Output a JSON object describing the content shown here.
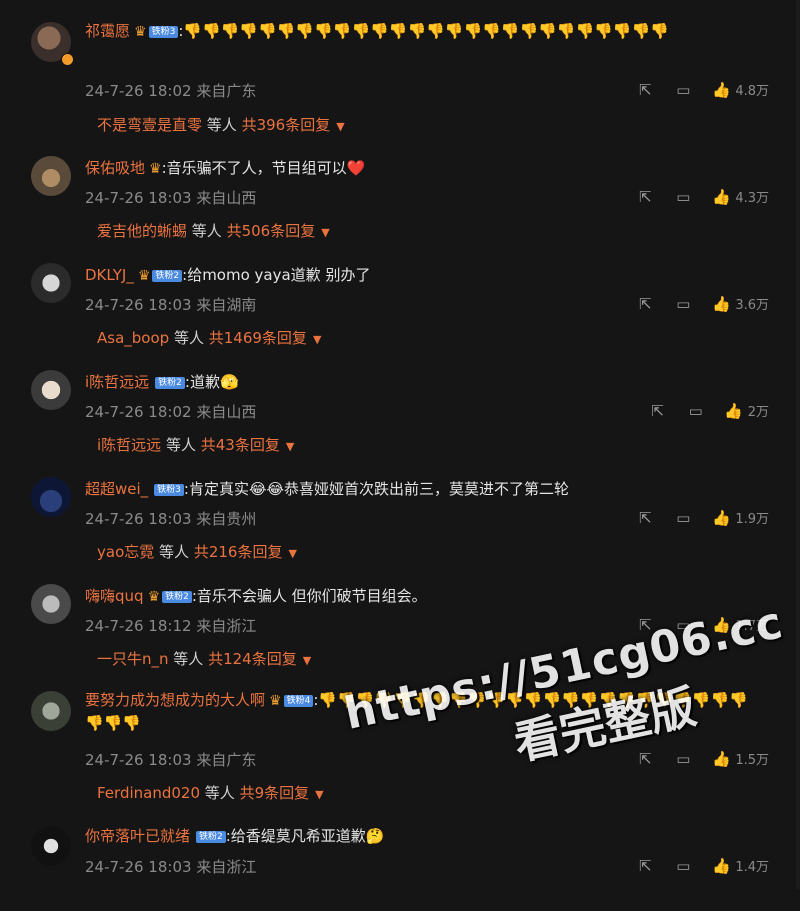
{
  "comments": [
    {
      "name": "祁霭愿",
      "fan": "铁粉3",
      "text": ":👎👎👎👎👎👎👎👎👎👎👎👎👎👎👎👎👎👎👎👎👎👎👎👎👎👎",
      "date": "24-7-26 18:02",
      "loc": "来自广东",
      "likes": "4.8万",
      "reply_user": "不是弯壹是直零",
      "reply_mid": "等人",
      "reply_count": "共396条回复"
    },
    {
      "name": "保佑吸地",
      "fan": "",
      "text": ":音乐骗不了人，节目组可以❤️",
      "date": "24-7-26 18:03",
      "loc": "来自山西",
      "likes": "4.3万",
      "reply_user": "爱吉他的蜥蜴",
      "reply_mid": "等人",
      "reply_count": "共506条回复"
    },
    {
      "name": "DKLYJ_",
      "fan": "铁粉2",
      "text": ":给momo yaya道歉 别办了",
      "date": "24-7-26 18:03",
      "loc": "来自湖南",
      "likes": "3.6万",
      "reply_user": "Asa_boop",
      "reply_mid": "等人",
      "reply_count": "共1469条回复"
    },
    {
      "name": "i陈哲远远",
      "fan": "铁粉2",
      "text": ":道歉🫣",
      "date": "24-7-26 18:02",
      "loc": "来自山西",
      "likes": "2万",
      "reply_user": "i陈哲远远",
      "reply_mid": "等人",
      "reply_count": "共43条回复"
    },
    {
      "name": "超超wei_",
      "fan": "铁粉3",
      "text": ":肯定真实😂😂恭喜娅娅首次跌出前三，莫莫进不了第二轮",
      "date": "24-7-26 18:03",
      "loc": "来自贵州",
      "likes": "1.9万",
      "reply_user": "yao忘霓",
      "reply_mid": "等人",
      "reply_count": "共216条回复"
    },
    {
      "name": "嗨嗨quq",
      "fan": "铁粉2",
      "text": ":音乐不会骗人 但你们破节目组会。",
      "date": "24-7-26 18:12",
      "loc": "来自浙江",
      "likes": "1.7万",
      "reply_user": "一只牛n_n",
      "reply_mid": "等人",
      "reply_count": "共124条回复"
    },
    {
      "name": "要努力成为想成为的大人啊",
      "fan": "铁粉4",
      "text": ":👎👎👎👎👎👎👎👎👎👎👎👎👎👎👎👎👎👎👎👎👎👎👎👎👎👎",
      "date": "24-7-26 18:03",
      "loc": "来自广东",
      "likes": "1.5万",
      "reply_user": "Ferdinand020",
      "reply_mid": "等人",
      "reply_count": "共9条回复"
    },
    {
      "name": "你帝落叶已就绪",
      "fan": "铁粉2",
      "text": ":给香缇莫凡希亚道歉🤔",
      "date": "24-7-26 18:03",
      "loc": "来自浙江",
      "likes": "1.4万",
      "reply_user": "",
      "reply_mid": "",
      "reply_count": ""
    }
  ],
  "watermark": {
    "line1": "https://51cg06.cc",
    "line2": "看完整版"
  },
  "icons": {
    "share": "share-icon",
    "comment": "comment-icon",
    "like": "like-icon",
    "caret": "caret-down-icon",
    "crown": "crown-icon",
    "verified": "verified-icon"
  }
}
